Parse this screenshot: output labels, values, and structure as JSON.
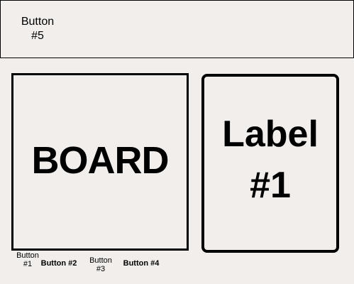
{
  "top_bar": {
    "button5_label": "Button\n#5"
  },
  "board": {
    "label": "BOARD"
  },
  "label1": {
    "text": "Label\n#1"
  },
  "bottom_buttons": [
    {
      "label": "Button\n#1"
    },
    {
      "label": "Button #2"
    },
    {
      "label": "Button\n#3"
    },
    {
      "label": "Button #4"
    }
  ]
}
